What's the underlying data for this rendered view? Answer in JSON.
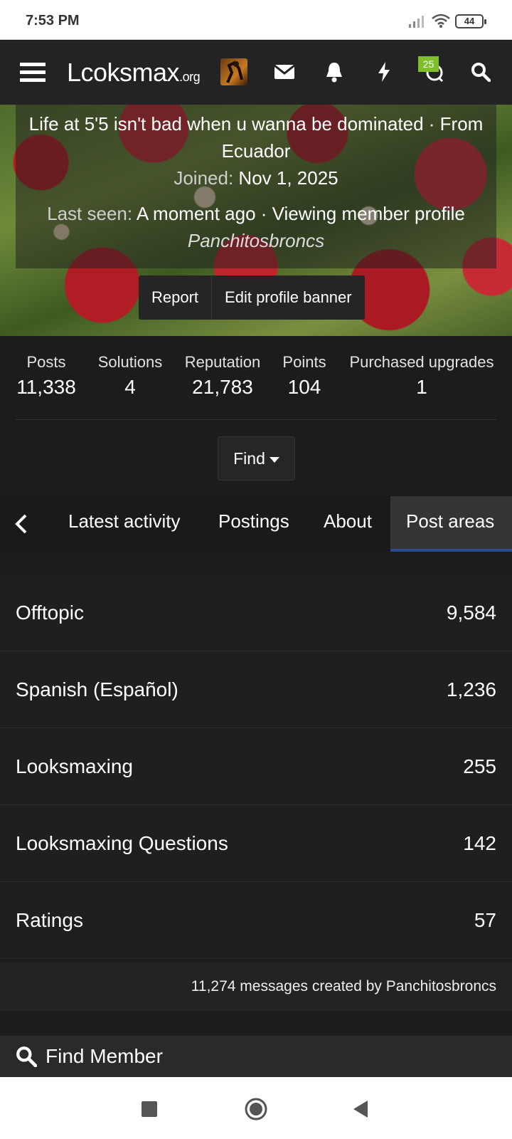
{
  "status_bar": {
    "time": "7:53 PM",
    "battery": "44"
  },
  "nav": {
    "logo_main": "Lcoksmax",
    "logo_suffix": ".org",
    "conversations_badge": "25"
  },
  "profile": {
    "tagline": "Life at 5'5 isn't bad when u wanna be dominated · From Ecuador",
    "joined_label": "Joined:",
    "joined_value": "Nov 1, 2025",
    "last_seen_label": "Last seen:",
    "last_seen_value": "A moment ago · Viewing member profile",
    "viewing_user": "Panchitosbroncs",
    "report_label": "Report",
    "edit_banner_label": "Edit profile banner"
  },
  "stats": [
    {
      "label": "Posts",
      "value": "11,338"
    },
    {
      "label": "Solutions",
      "value": "4"
    },
    {
      "label": "Reputation",
      "value": "21,783"
    },
    {
      "label": "Points",
      "value": "104"
    },
    {
      "label": "Purchased upgrades",
      "value": "1"
    }
  ],
  "find_label": "Find",
  "tabs": [
    {
      "label": "Latest activity"
    },
    {
      "label": "Postings"
    },
    {
      "label": "About"
    },
    {
      "label": "Post areas",
      "active": true
    }
  ],
  "post_areas": [
    {
      "name": "Offtopic",
      "count": "9,584"
    },
    {
      "name": "Spanish (Español)",
      "count": "1,236"
    },
    {
      "name": "Looksmaxing",
      "count": "255"
    },
    {
      "name": "Looksmaxing Questions",
      "count": "142"
    },
    {
      "name": "Ratings",
      "count": "57"
    }
  ],
  "summary": "11,274 messages created by Panchitosbroncs",
  "find_member_label": "Find Member",
  "colors": {
    "background": "#1c1c1c",
    "badge": "#7fbf2a",
    "active_tab_underline": "#2b4a8c"
  }
}
